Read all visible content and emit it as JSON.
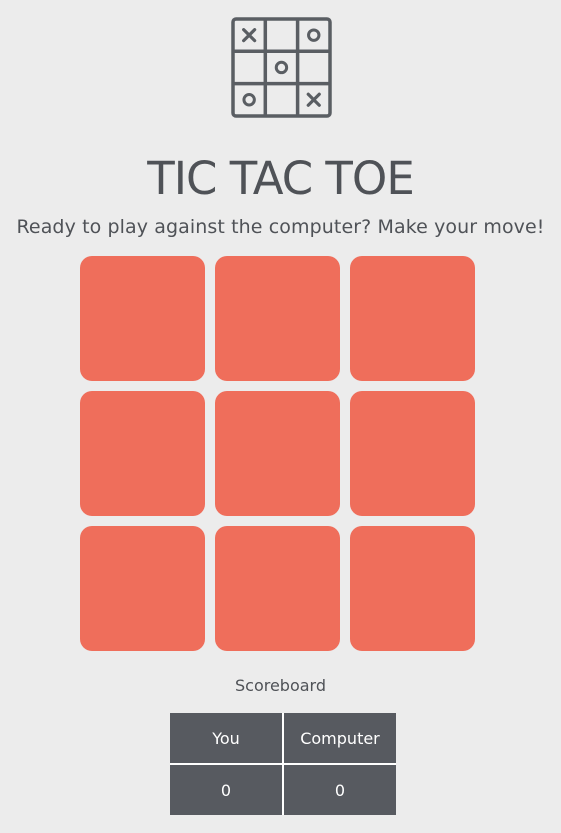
{
  "logo": {
    "icon": "tic-tac-toe-logo-icon",
    "grid": [
      [
        "X",
        "",
        "O"
      ],
      [
        "",
        "O",
        ""
      ],
      [
        "O",
        "",
        "X"
      ]
    ]
  },
  "header": {
    "title": "TIC TAC TOE",
    "subtitle": "Ready to play against the computer? Make your move!"
  },
  "board": {
    "cells": [
      "",
      "",
      "",
      "",
      "",
      "",
      "",
      "",
      ""
    ],
    "cell_color": "#ef6e5b"
  },
  "scoreboard": {
    "label": "Scoreboard",
    "headers": [
      "You",
      "Computer"
    ],
    "scores": [
      "0",
      "0"
    ],
    "cell_color": "#575a60"
  },
  "colors": {
    "background": "#ececec",
    "text": "#4f5257"
  }
}
